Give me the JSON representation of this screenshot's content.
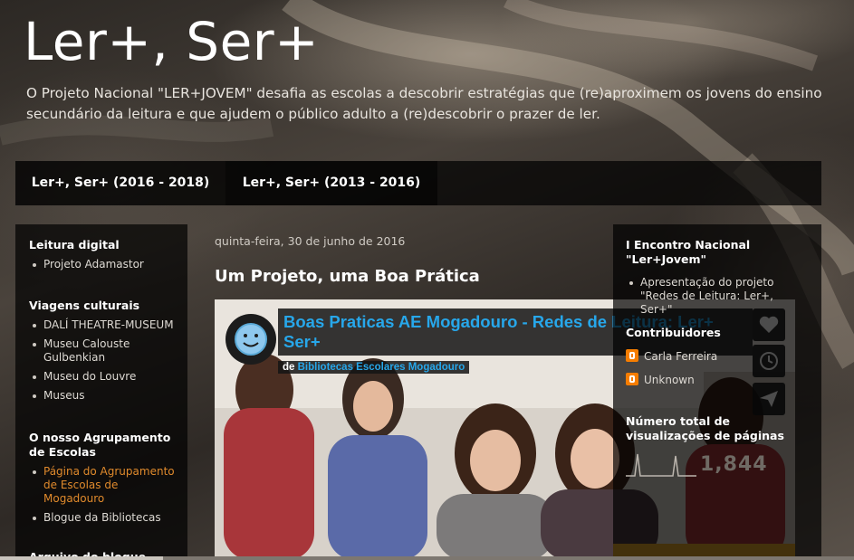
{
  "header": {
    "title": "Ler+, Ser+",
    "description": "O Projeto Nacional \"LER+JOVEM\" desafia as escolas a descobrir estratégias que (re)aproximem os jovens do ensino secundário da leitura e que ajudem o público adulto a (re)descobrir o prazer de ler."
  },
  "nav": {
    "tabs": [
      {
        "label": "Ler+, Ser+ (2016 - 2018)"
      },
      {
        "label": "Ler+, Ser+ (2013 - 2016)"
      }
    ]
  },
  "sidebar_left": {
    "widgets": [
      {
        "title": "Leitura digital",
        "items": [
          "Projeto Adamastor"
        ]
      },
      {
        "title": "Viagens culturais",
        "items": [
          "DALÍ THEATRE-MUSEUM",
          "Museu Calouste Gulbenkian",
          "Museu do Louvre",
          "Museus"
        ]
      },
      {
        "title": "O nosso Agrupamento de Escolas",
        "items": [
          "Página do Agrupamento de Escolas de Mogadouro",
          "Blogue da Bibliotecas"
        ]
      },
      {
        "title": "Arquivo do blogue",
        "items": []
      }
    ]
  },
  "post": {
    "date": "quinta-feira, 30 de junho de 2016",
    "title": "Um Projeto, uma Boa Prática",
    "video": {
      "title": "Boas Praticas AE Mogadouro - Redes de Leitura: Ler+ Ser+",
      "by_prefix": "de",
      "channel": "Bibliotecas Escolares Mogadouro",
      "buttons": [
        "heart-icon",
        "clock-icon",
        "send-icon"
      ]
    }
  },
  "sidebar_right": {
    "encontro_title": "I Encontro Nacional \"Ler+Jovem\"",
    "encontro_item": "Apresentação do projeto \"Redes de Leitura: Ler+, Ser+\"",
    "contributors_title": "Contribuidores",
    "contributors": [
      "Carla Ferreira",
      "Unknown"
    ],
    "stats_title": "Número total de visualizações de páginas",
    "stats_count": "1,844"
  },
  "colors": {
    "accent_link": "#e08a2c",
    "video_title": "#27a7ea",
    "blogger_orange": "#f57d00"
  }
}
